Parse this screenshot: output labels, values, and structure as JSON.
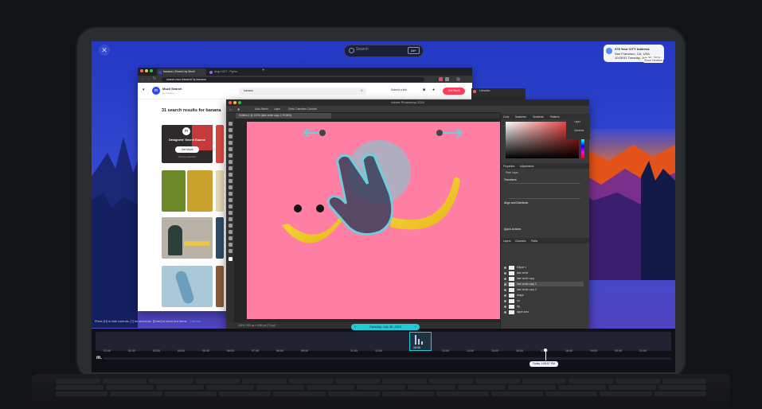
{
  "top_bar": {
    "search_placeholder": "Search",
    "search_shortcut": "Alt+",
    "weather_location": "378 Your CITY Address",
    "weather_city": "San Francisco, CA, USA",
    "weather_time": "10:08:51 Tuesday, July 30, 2024",
    "weather_badge": "Show Timeline"
  },
  "browser": {
    "tabs": [
      "banana | Search by Muzli",
      "Ango NUT - Figma"
    ],
    "url": "search.muz.li/search?q=banana",
    "app_name": "Muzli Search",
    "app_sub": "by InVision",
    "search_value": "banana",
    "submit_link": "Submit a link",
    "get_button": "Get Muzli",
    "results_title": "31 search results for banana",
    "promo_title": "Designers' Secret Source",
    "promo_button": "Get Muzli",
    "promo_sub": "Chrome extension"
  },
  "photoshop": {
    "title": "Adobe Photoshop 2024",
    "doc_tab": "Untitled-1 @ 100% (fake smile copy 2, RGB/8)",
    "options": [
      "Auto-Select:",
      "Layer",
      "Show Transform Controls"
    ],
    "status": "100%   1920 px x 1080 px (72 ppi)",
    "panels": {
      "color_tabs": [
        "Color",
        "Swatches",
        "Gradients",
        "Patterns"
      ],
      "properties_tabs": [
        "Properties",
        "Adjustments"
      ],
      "properties_labels": [
        "Pixel Layer",
        "Transform",
        "Align and Distribute",
        "Quick Actions"
      ],
      "layers_tabs": [
        "Layers",
        "Channels",
        "Paths"
      ],
      "layers": [
        "Ellipse 1",
        "fake smile",
        "fake smile copy",
        "fake smile copy 2",
        "fake smile copy 3",
        "shape",
        "nu",
        "bg",
        "apple area"
      ]
    },
    "libraries": "Libraries",
    "right_panel": [
      "Layer",
      "Libraries"
    ]
  },
  "hint": {
    "text": "Press [H] to hide controls, [?] for shortcuts, [Enter] to show text items",
    "dismiss": "Dismiss"
  },
  "timeline": {
    "date": "Tuesday, July 30, 2024",
    "selected_time": "10:00",
    "now_label": "Today 1:08:57 PM",
    "logo": "m.",
    "times": [
      "01:00",
      "02:00",
      "03:00",
      "04:00",
      "05:00",
      "06:00",
      "07:00",
      "08:00",
      "09:00",
      "10:00",
      "11:00",
      "12:00",
      "13:00",
      "14:00",
      "15:00",
      "16:00",
      "17:00",
      "18:00",
      "19:00",
      "20:00",
      "21:00",
      "22:00",
      "23:00"
    ]
  },
  "colors": {
    "wallpaper_sky": "#2a40c9",
    "canvas": "#ff7fa4",
    "accent_cyan": "#22c9d8",
    "muzli_red": "#ff3d5a"
  }
}
